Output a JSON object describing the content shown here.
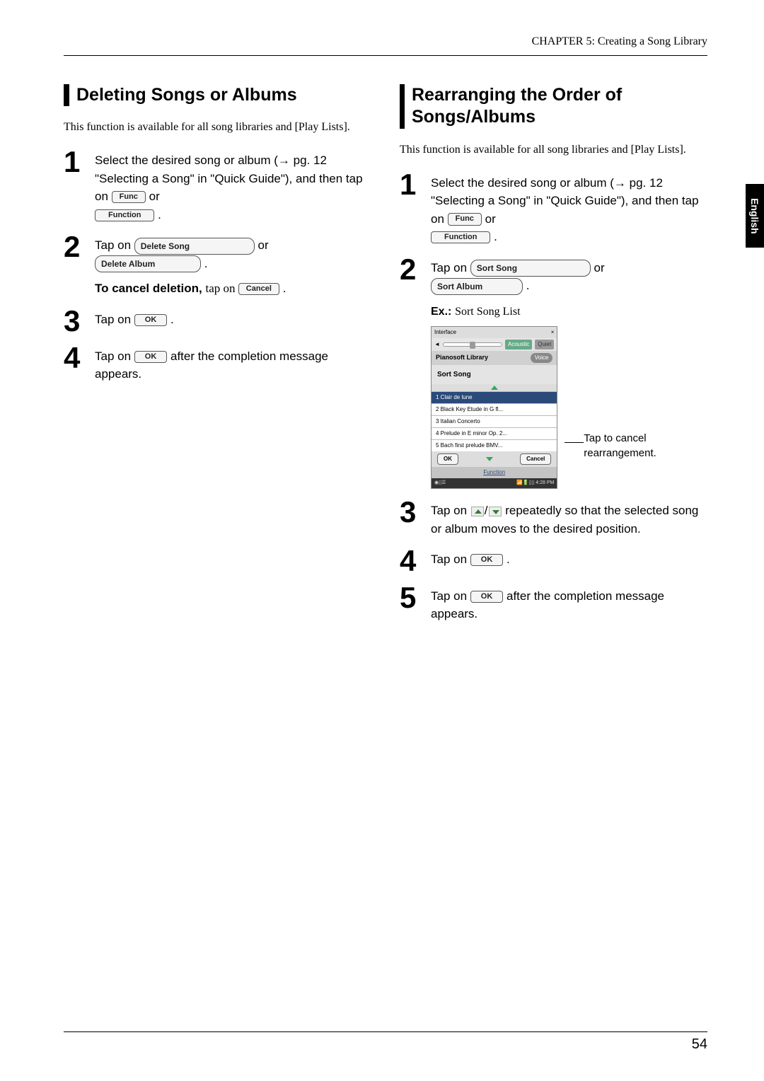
{
  "chapter_header": "CHAPTER 5: Creating a Song Library",
  "side_tab": "English",
  "page_number": "54",
  "buttons": {
    "func": "Func",
    "function": "Function",
    "delete_song": "Delete Song",
    "delete_album": "Delete Album",
    "cancel": "Cancel",
    "ok": "OK",
    "sort_song": "Sort Song",
    "sort_album": "Sort Album"
  },
  "left": {
    "title": "Deleting Songs or Albums",
    "intro": "This function is available for all song libraries and [Play Lists].",
    "step1": "Select the desired song or album (→ pg. 12 \"Selecting a Song\" in \"Quick Guide\"), and then tap on ",
    "step1_or": " or ",
    "step1_end": ".",
    "step2_a": "Tap on ",
    "step2_or": " or ",
    "step2_end": ".",
    "step2_cancel_a": "To cancel deletion,",
    "step2_cancel_b": " tap on ",
    "step2_cancel_end": ".",
    "step3_a": "Tap on ",
    "step3_end": ".",
    "step4_a": "Tap on ",
    "step4_b": " after the completion message appears."
  },
  "right": {
    "title": "Rearranging the Order of Songs/Albums",
    "intro": "This function is available for all song libraries and [Play Lists].",
    "step1": "Select the desired song or album (→ pg. 12 \"Selecting a Song\" in \"Quick Guide\"), and then tap on ",
    "step1_or": " or ",
    "step1_end": ".",
    "step2_a": "Tap on ",
    "step2_or": " or ",
    "step2_end": ".",
    "ex_label": "Ex.:",
    "ex_text": " Sort Song List",
    "callout": "Tap to cancel rearrangement.",
    "step3_a": "Tap on ",
    "step3_b": " repeatedly so that the selected song or album moves to the desired position.",
    "step4_a": "Tap on ",
    "step4_end": ".",
    "step5_a": "Tap on ",
    "step5_b": " after the completion message appears."
  },
  "screenshot": {
    "topleft": "Interface",
    "close": "×",
    "tab_acoustic": "Acoustic",
    "tab_quiet": "Quiet",
    "library": "Pianosoft Library",
    "voice_btn": "Voice",
    "sort_label": "Sort Song",
    "rows": [
      "1 Clair de lune",
      "2 Black Key Etude in G fl...",
      "3 Italian Concerto",
      "4 Prelude in E minor Op. 2...",
      "5 Bach first prelude BMV..."
    ],
    "ok": "OK",
    "cancel": "Cancel",
    "function": "Function",
    "time": "4:28 PM"
  }
}
